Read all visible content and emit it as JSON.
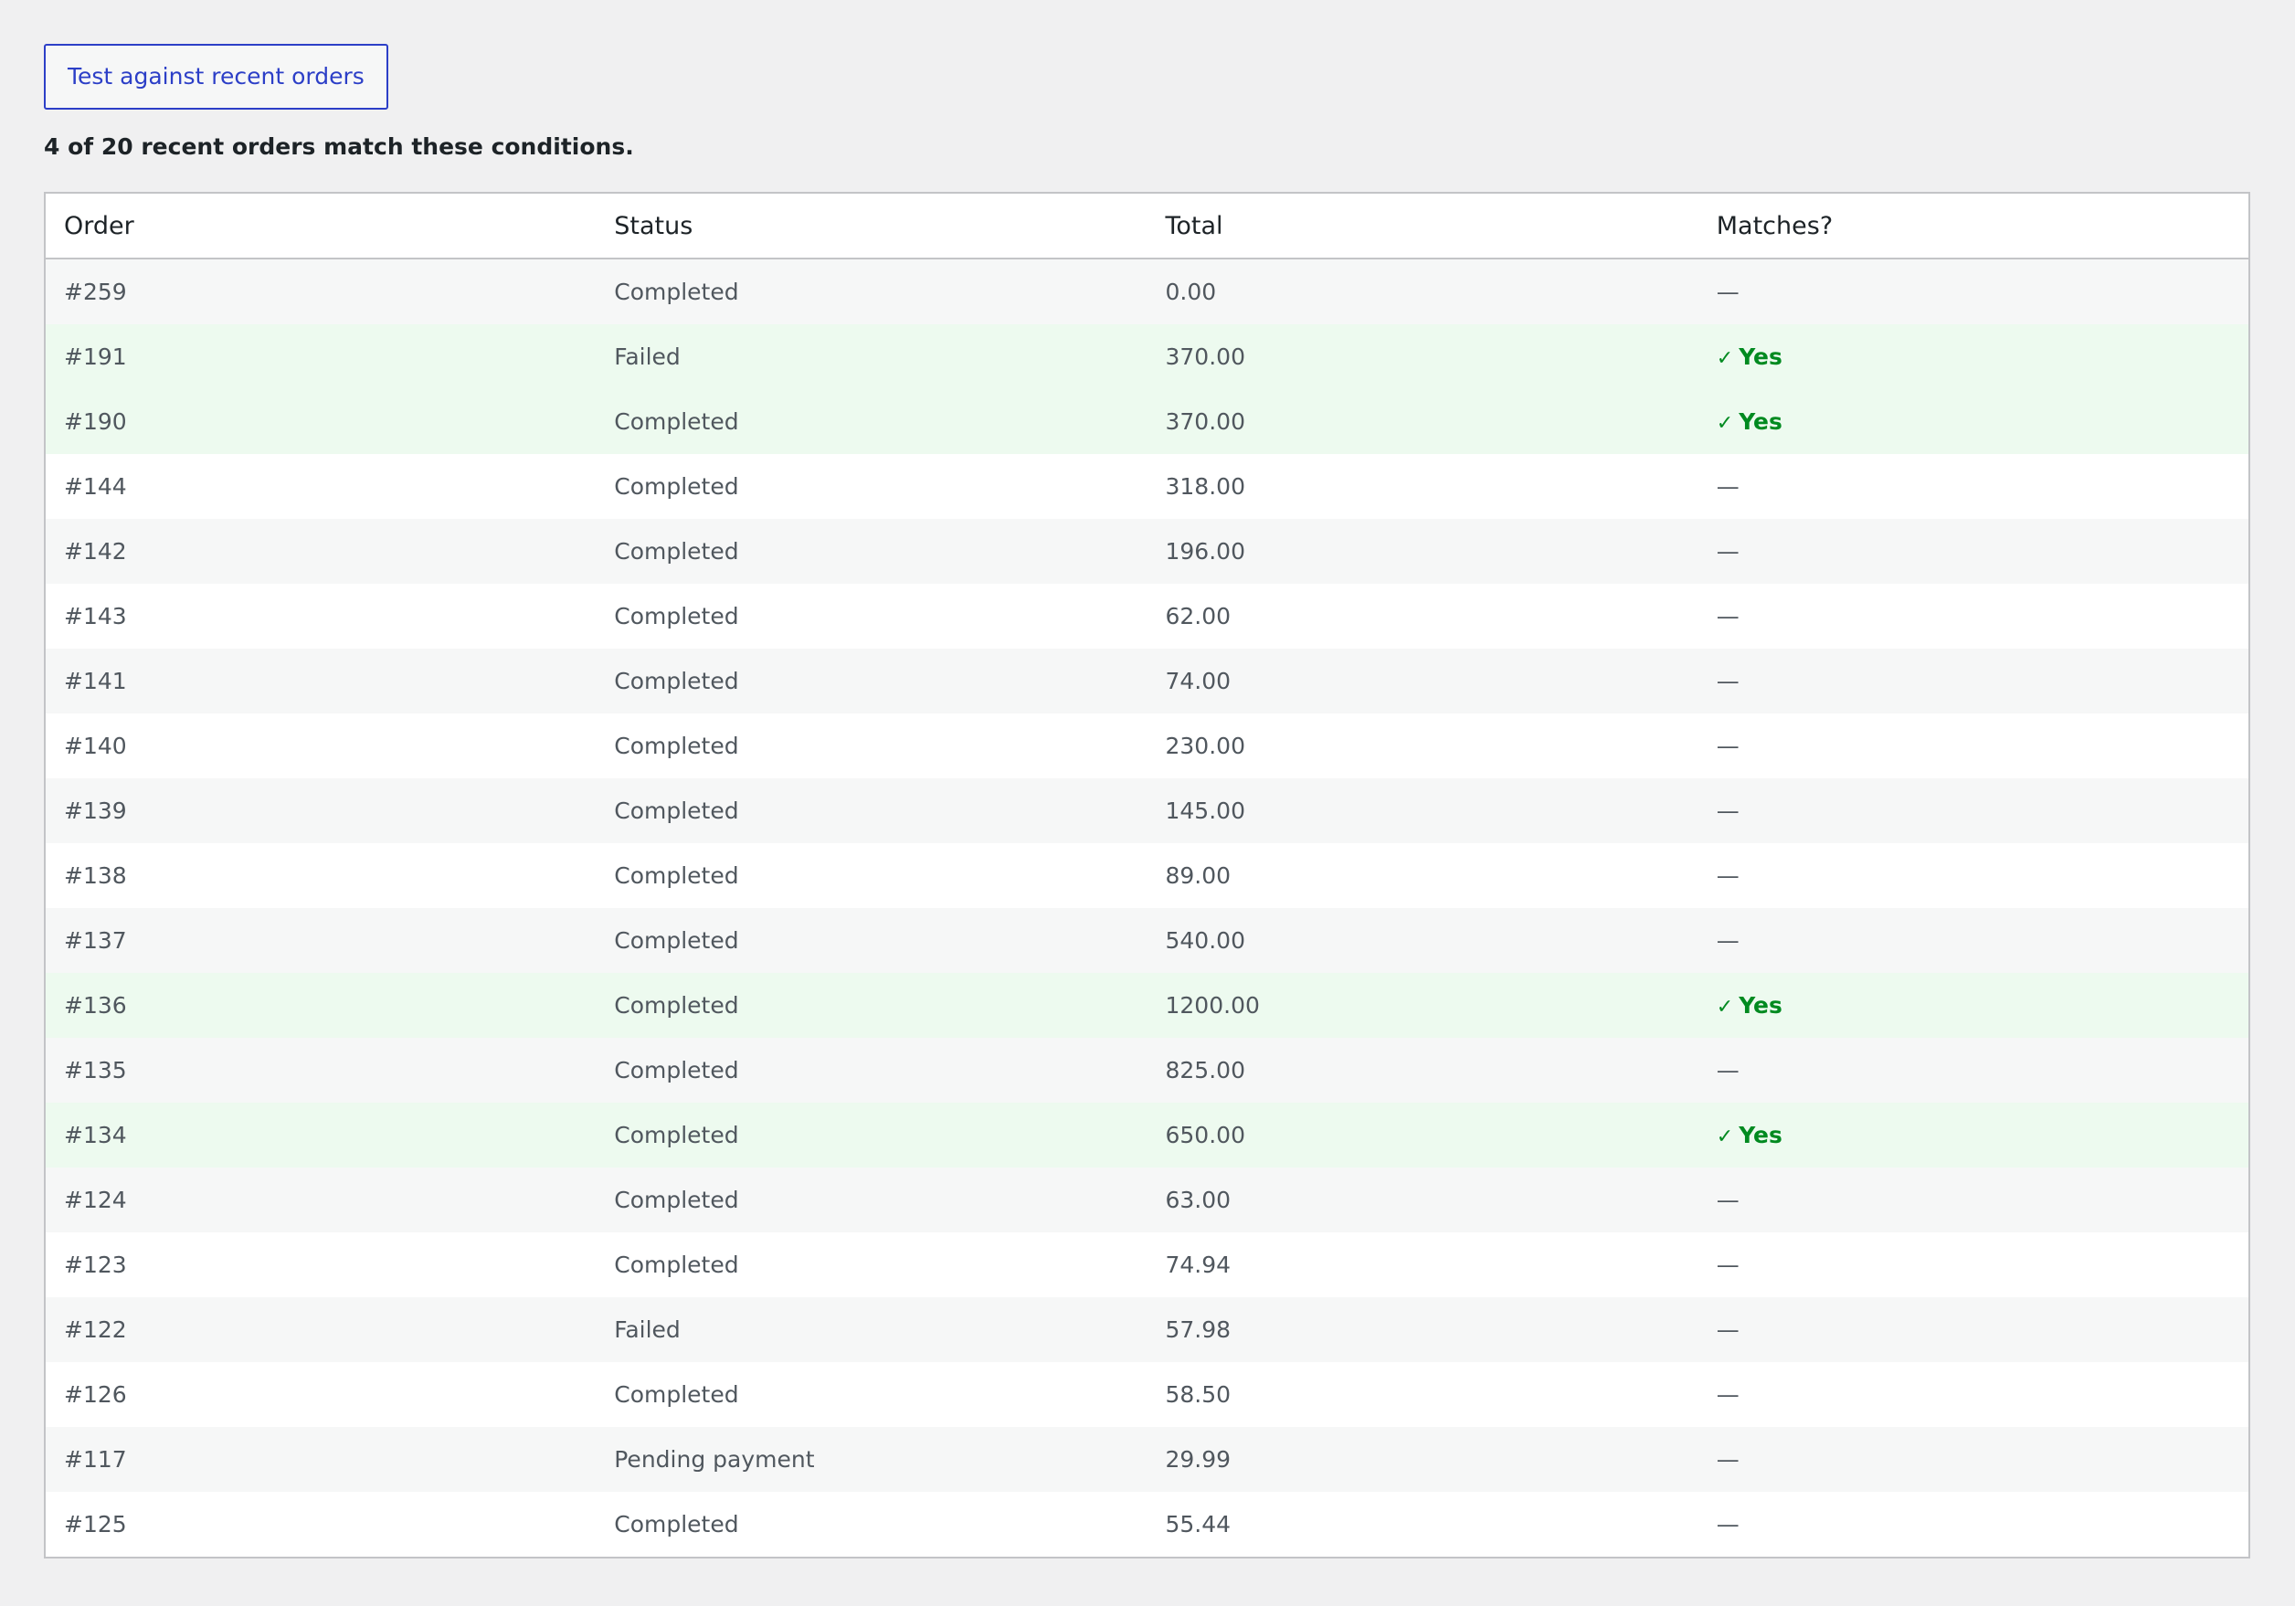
{
  "test_button": {
    "label": "Test against recent orders"
  },
  "summary": "4 of 20 recent orders match these conditions.",
  "table": {
    "columns": [
      "Order",
      "Status",
      "Total",
      "Matches?"
    ],
    "yes_label": "Yes",
    "no_label": "—",
    "rows": [
      {
        "order": "#259",
        "status": "Completed",
        "total": "0.00",
        "match": false
      },
      {
        "order": "#191",
        "status": "Failed",
        "total": "370.00",
        "match": true
      },
      {
        "order": "#190",
        "status": "Completed",
        "total": "370.00",
        "match": true
      },
      {
        "order": "#144",
        "status": "Completed",
        "total": "318.00",
        "match": false
      },
      {
        "order": "#142",
        "status": "Completed",
        "total": "196.00",
        "match": false
      },
      {
        "order": "#143",
        "status": "Completed",
        "total": "62.00",
        "match": false
      },
      {
        "order": "#141",
        "status": "Completed",
        "total": "74.00",
        "match": false
      },
      {
        "order": "#140",
        "status": "Completed",
        "total": "230.00",
        "match": false
      },
      {
        "order": "#139",
        "status": "Completed",
        "total": "145.00",
        "match": false
      },
      {
        "order": "#138",
        "status": "Completed",
        "total": "89.00",
        "match": false
      },
      {
        "order": "#137",
        "status": "Completed",
        "total": "540.00",
        "match": false
      },
      {
        "order": "#136",
        "status": "Completed",
        "total": "1200.00",
        "match": true
      },
      {
        "order": "#135",
        "status": "Completed",
        "total": "825.00",
        "match": false
      },
      {
        "order": "#134",
        "status": "Completed",
        "total": "650.00",
        "match": true
      },
      {
        "order": "#124",
        "status": "Completed",
        "total": "63.00",
        "match": false
      },
      {
        "order": "#123",
        "status": "Completed",
        "total": "74.94",
        "match": false
      },
      {
        "order": "#122",
        "status": "Failed",
        "total": "57.98",
        "match": false
      },
      {
        "order": "#126",
        "status": "Completed",
        "total": "58.50",
        "match": false
      },
      {
        "order": "#117",
        "status": "Pending payment",
        "total": "29.99",
        "match": false
      },
      {
        "order": "#125",
        "status": "Completed",
        "total": "55.44",
        "match": false
      }
    ]
  },
  "colors": {
    "accent": "#2c3fc7",
    "match_green": "#008a20",
    "match_row_bg": "#edfaef"
  },
  "icons": {
    "match": "checkmark-icon"
  }
}
